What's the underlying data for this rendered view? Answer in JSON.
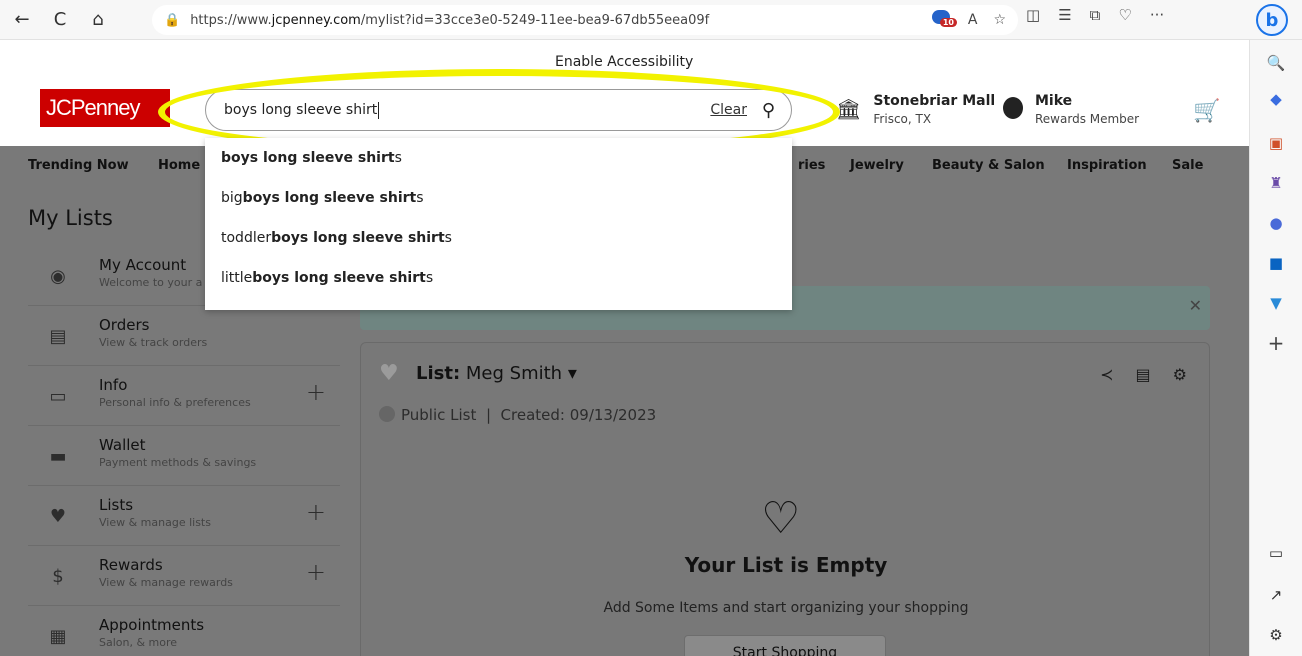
{
  "browser": {
    "back": "←",
    "refresh": "C",
    "home": "⌂",
    "lock": "🔒",
    "url_prefix": "https://www.",
    "url_domain": "jcpenney.com",
    "url_path": "/mylist?id=33cce3e0-5249-11ee-bea9-67db55eea09f",
    "extension_badge": "10",
    "read_aloud": "A",
    "favorite": "☆",
    "split": "◫",
    "favorites": "☰",
    "collections": "⧉",
    "health": "♡",
    "more": "···",
    "copilot": "b"
  },
  "sidebar_icons": [
    "search-icon",
    "tag-icon",
    "briefcase-icon",
    "chess-icon",
    "office-icon",
    "outlook-icon",
    "send-icon",
    "add-icon",
    "sidebar-toggle-icon",
    "external-link-icon",
    "settings-icon"
  ],
  "header": {
    "enable_accessibility": "Enable Accessibility",
    "logo": "JCPenney",
    "search_value": "boys long sleeve shirt",
    "clear_label": "Clear",
    "store_name": "Stonebriar Mall",
    "store_location": "Frisco, TX",
    "account_name": "Mike",
    "account_sub": "Rewards Member"
  },
  "suggestions": [
    {
      "prefix": "",
      "bold": "boys long sleeve shirt",
      "suffix": "s"
    },
    {
      "prefix": "big ",
      "bold": "boys long sleeve shirt",
      "suffix": "s"
    },
    {
      "prefix": "toddler ",
      "bold": "boys long sleeve shirt",
      "suffix": "s"
    },
    {
      "prefix": "little ",
      "bold": "boys long sleeve shirt",
      "suffix": "s"
    }
  ],
  "nav": {
    "trending": "Trending Now",
    "home": "Home",
    "ries": "ries",
    "jewelry": "Jewelry",
    "beauty": "Beauty & Salon",
    "inspiration": "Inspiration",
    "sale": "Sale"
  },
  "my_lists_title": "My Lists",
  "menu": [
    {
      "title": "My Account",
      "sub": "Welcome to your a",
      "plus": ""
    },
    {
      "title": "Orders",
      "sub": "View & track orders",
      "plus": ""
    },
    {
      "title": "Info",
      "sub": "Personal info & preferences",
      "plus": "+"
    },
    {
      "title": "Wallet",
      "sub": "Payment methods & savings",
      "plus": ""
    },
    {
      "title": "Lists",
      "sub": "View & manage lists",
      "plus": "+"
    },
    {
      "title": "Rewards",
      "sub": "View & manage rewards",
      "plus": "+"
    },
    {
      "title": "Appointments",
      "sub": "Salon, & more",
      "plus": ""
    }
  ],
  "list": {
    "label": "List:",
    "name": "Meg Smith",
    "dropdown": "▾",
    "visibility": "Public List",
    "separator": "|",
    "created": "Created: 09/13/2023",
    "empty_title": "Your List is Empty",
    "empty_sub": "Add Some Items and start organizing your shopping",
    "start_button": "Start Shopping"
  },
  "colors": {
    "brand_red": "#cc0000",
    "highlight": "#f2f200",
    "overlay": "#797979"
  }
}
